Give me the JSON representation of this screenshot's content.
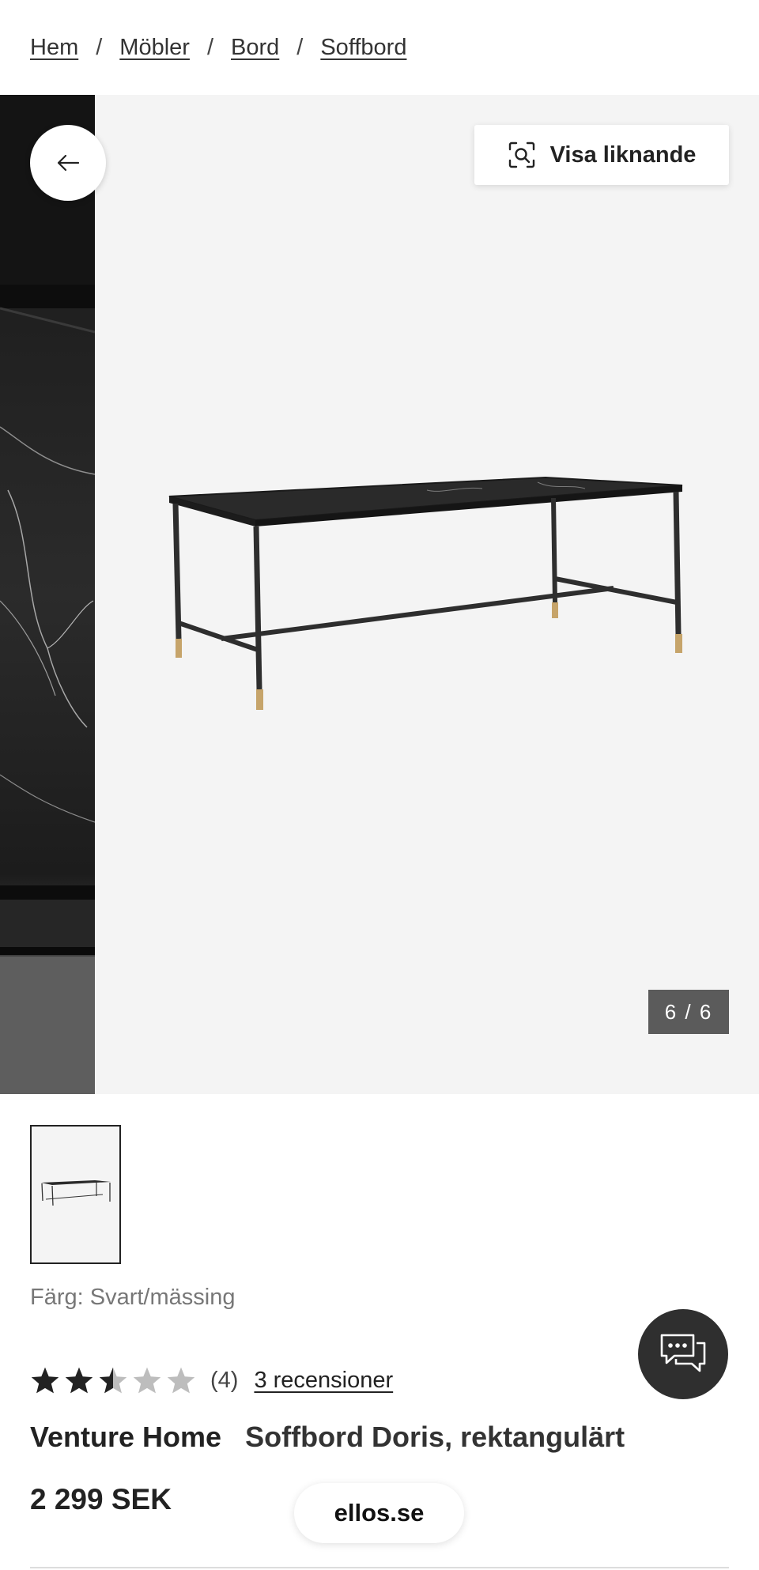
{
  "breadcrumb": {
    "items": [
      "Hem",
      "Möbler",
      "Bord",
      "Soffbord"
    ],
    "separator": "/"
  },
  "gallery": {
    "similar_label": "Visa liknande",
    "counter": "6 / 6",
    "current_index": 6,
    "total": 6
  },
  "product": {
    "color_text": "Färg: Svart/mässing",
    "rating_value": 2.5,
    "rating_max": 5,
    "rating_count_text": "(4)",
    "reviews_link": "3 recensioner",
    "brand": "Venture Home",
    "name": "Soffbord Doris, rektangulärt",
    "price": "2 299 SEK"
  },
  "site_badge": "ellos.se",
  "icons": {
    "back": "arrow-left-icon",
    "similar": "visual-search-icon",
    "chat": "chat-bubbles-icon",
    "star": "star-icon"
  },
  "colors": {
    "text": "#222222",
    "muted": "#777777",
    "counter_bg": "#5b5b5b",
    "chat_bg": "#2f2f2f",
    "star_filled": "#222222",
    "star_empty": "#bdbdbd",
    "gallery_bg": "#f4f4f4"
  }
}
